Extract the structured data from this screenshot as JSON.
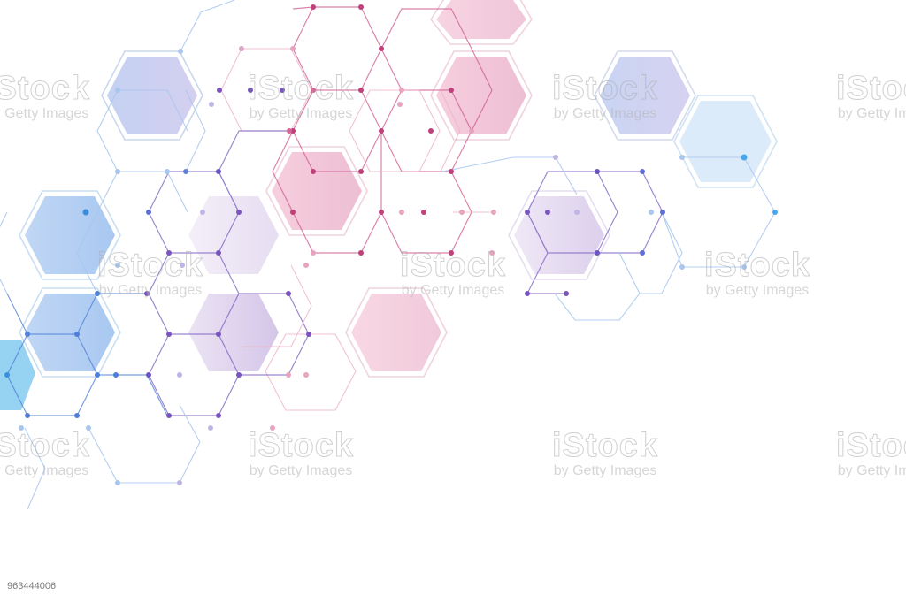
{
  "image": {
    "description": "Abstract hexagon molecular pattern background with connected nodes",
    "stock_id": "963444006",
    "watermark": {
      "brand": "iStock",
      "sub": "by Getty Images"
    },
    "colors": {
      "background": "#ffffff",
      "blue": "#5a8fe0",
      "cyan": "#39a9e8",
      "purple": "#7a5cc8",
      "magenta": "#c8407e",
      "pink_fill": "#f2c4d6",
      "blue_fill": "#b7cff2",
      "lavender_fill": "#d9cdea"
    }
  }
}
